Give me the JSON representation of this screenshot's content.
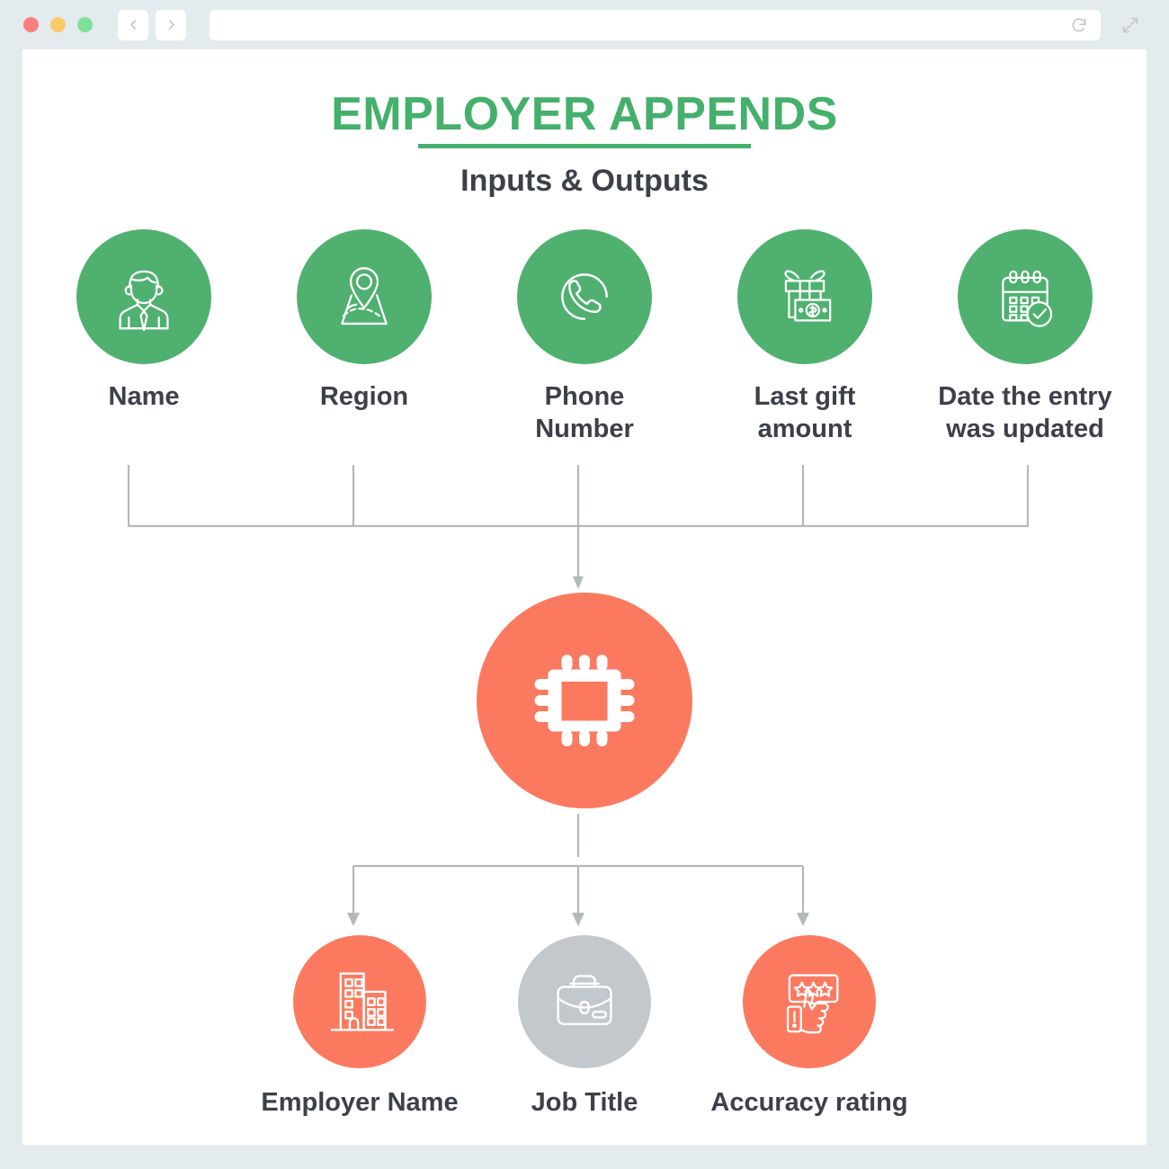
{
  "browser": {
    "traffic_lights": [
      "close-red",
      "minimize-yellow",
      "maximize-green"
    ],
    "back_icon": "chevron-left-icon",
    "forward_icon": "chevron-right-icon",
    "url_value": "",
    "url_placeholder": "",
    "reload_icon": "reload-icon",
    "expand_icon": "expand-arrows-icon"
  },
  "header": {
    "title": "EMPLOYER APPENDS",
    "subtitle": "Inputs & Outputs"
  },
  "colors": {
    "accent_green": "#4fb070",
    "accent_coral": "#fb7a5f",
    "accent_gray": "#c2c8cb",
    "text_dark": "#3b4049",
    "page_bg": "#e4ebee",
    "wire": "#b3b8bb"
  },
  "inputs": [
    {
      "label": "Name",
      "icon": "businessman-icon",
      "color": "green"
    },
    {
      "label": "Region",
      "icon": "map-pin-icon",
      "color": "green"
    },
    {
      "label": "Phone\nNumber",
      "icon": "phone-icon",
      "color": "green"
    },
    {
      "label": "Last gift\namount",
      "icon": "gift-money-icon",
      "color": "green"
    },
    {
      "label": "Date the entry\nwas updated",
      "icon": "calendar-check-icon",
      "color": "green"
    }
  ],
  "processor": {
    "icon": "cpu-chip-icon",
    "color": "coral"
  },
  "outputs": [
    {
      "label": "Employer Name",
      "icon": "office-building-icon",
      "color": "coral"
    },
    {
      "label": "Job Title",
      "icon": "briefcase-icon",
      "color": "gray"
    },
    {
      "label": "Accuracy rating",
      "icon": "thumbs-up-stars-icon",
      "color": "coral"
    }
  ]
}
